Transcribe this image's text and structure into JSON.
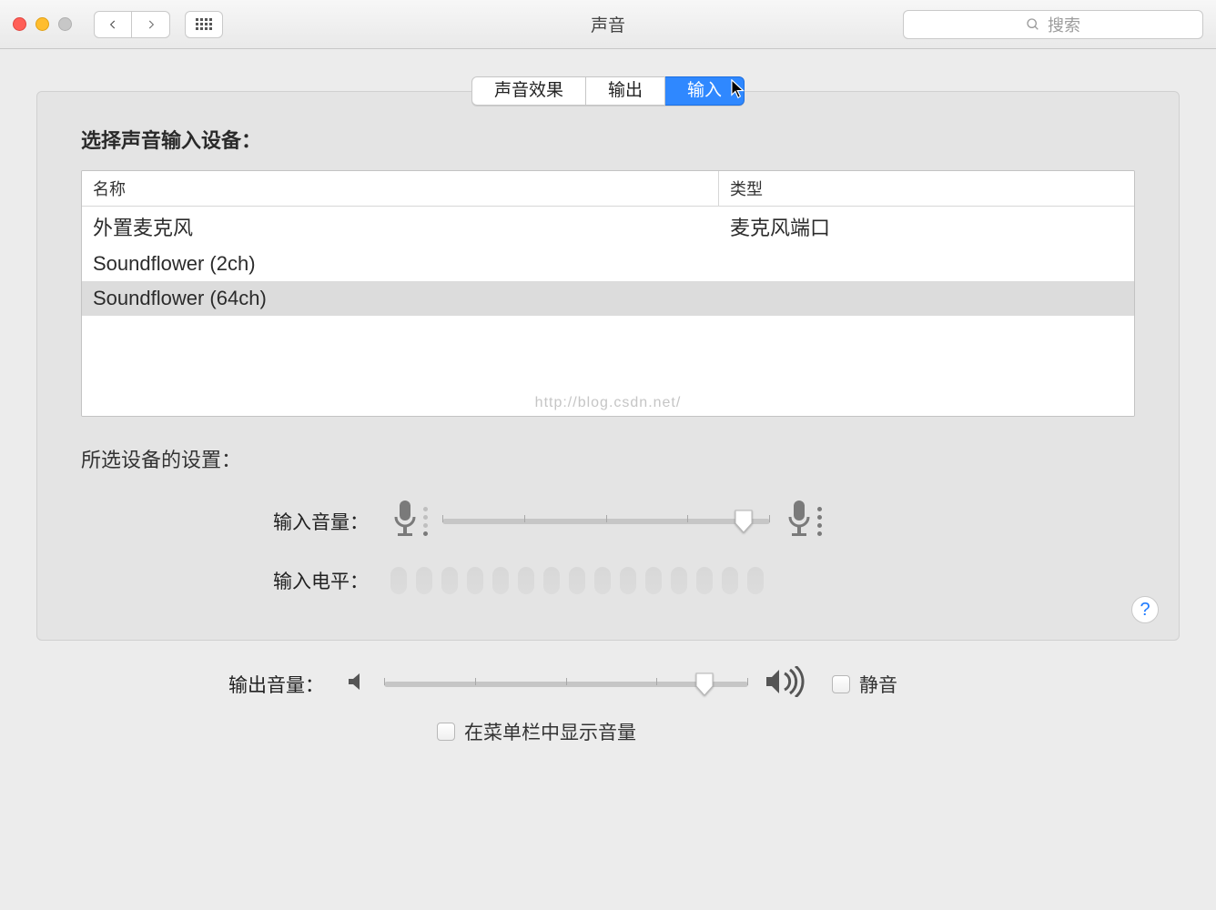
{
  "window": {
    "title": "声音"
  },
  "search": {
    "placeholder": "搜索"
  },
  "tabs": {
    "effects": "声音效果",
    "output": "输出",
    "input": "输入",
    "active": "input"
  },
  "input": {
    "section_title": "选择声音输入设备：",
    "columns": {
      "name": "名称",
      "type": "类型"
    },
    "devices": [
      {
        "name": "外置麦克风",
        "type": "麦克风端口",
        "selected": false
      },
      {
        "name": "Soundflower (2ch)",
        "type": "",
        "selected": false
      },
      {
        "name": "Soundflower (64ch)",
        "type": "",
        "selected": true
      }
    ],
    "settings_title": "所选设备的设置：",
    "volume_label": "输入音量：",
    "volume_percent": 92,
    "level_label": "输入电平：",
    "level_leds": 15
  },
  "output_volume": {
    "label": "输出音量：",
    "percent": 88,
    "mute_label": "静音",
    "mute_checked": false,
    "show_in_menubar_label": "在菜单栏中显示音量",
    "show_in_menubar_checked": false
  },
  "watermark": "http://blog.csdn.net/",
  "help": "?"
}
